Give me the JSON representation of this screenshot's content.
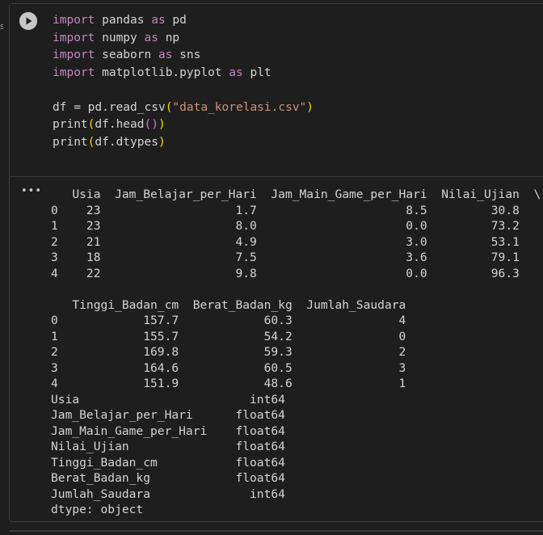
{
  "gutter": {
    "mark": "s"
  },
  "code": {
    "lines": [
      [
        {
          "t": "import",
          "c": "kw"
        },
        {
          "t": " pandas ",
          "c": "id"
        },
        {
          "t": "as",
          "c": "kw"
        },
        {
          "t": " pd",
          "c": "id"
        }
      ],
      [
        {
          "t": "import",
          "c": "kw"
        },
        {
          "t": " numpy ",
          "c": "id"
        },
        {
          "t": "as",
          "c": "kw"
        },
        {
          "t": " np",
          "c": "id"
        }
      ],
      [
        {
          "t": "import",
          "c": "kw"
        },
        {
          "t": " seaborn ",
          "c": "id"
        },
        {
          "t": "as",
          "c": "kw"
        },
        {
          "t": " sns",
          "c": "id"
        }
      ],
      [
        {
          "t": "import",
          "c": "kw"
        },
        {
          "t": " matplotlib.pyplot ",
          "c": "id"
        },
        {
          "t": "as",
          "c": "kw"
        },
        {
          "t": " plt",
          "c": "id"
        }
      ],
      [],
      [
        {
          "t": "df = pd.read_csv",
          "c": "id"
        },
        {
          "t": "(",
          "c": "br1"
        },
        {
          "t": "\"data_korelasi.csv\"",
          "c": "str"
        },
        {
          "t": ")",
          "c": "br1"
        }
      ],
      [
        {
          "t": "print",
          "c": "id"
        },
        {
          "t": "(",
          "c": "br1"
        },
        {
          "t": "df.head",
          "c": "id"
        },
        {
          "t": "()",
          "c": "br2"
        },
        {
          "t": ")",
          "c": "br1"
        }
      ],
      [
        {
          "t": "print",
          "c": "id"
        },
        {
          "t": "(",
          "c": "br1"
        },
        {
          "t": "df.dtypes",
          "c": "id"
        },
        {
          "t": ")",
          "c": "br1"
        }
      ]
    ]
  },
  "output": {
    "menu_label": "•••",
    "lines": [
      "   Usia  Jam_Belajar_per_Hari  Jam_Main_Game_per_Hari  Nilai_Ujian  \\",
      "0    23                   1.7                     8.5         30.8   ",
      "1    23                   8.0                     0.0         73.2   ",
      "2    21                   4.9                     3.0         53.1   ",
      "3    18                   7.5                     3.6         79.1   ",
      "4    22                   9.8                     0.0         96.3   ",
      "",
      "   Tinggi_Badan_cm  Berat_Badan_kg  Jumlah_Saudara  ",
      "0            157.7            60.3               4  ",
      "1            155.7            54.2               0  ",
      "2            169.8            59.3               2  ",
      "3            164.6            60.5               3  ",
      "4            151.9            48.6               1  ",
      "Usia                        int64",
      "Jam_Belajar_per_Hari      float64",
      "Jam_Main_Game_per_Hari    float64",
      "Nilai_Ujian               float64",
      "Tinggi_Badan_cm           float64",
      "Berat_Badan_kg            float64",
      "Jumlah_Saudara              int64",
      "dtype: object"
    ]
  },
  "icons": {
    "run": "play-icon",
    "menu": "more-horizontal-icon"
  },
  "colors": {
    "background": "#1e1e1e",
    "keyword": "#c586c0",
    "string": "#ce9178",
    "bracket_outer": "#ffd700",
    "bracket_inner": "#da70d6",
    "text": "#d4d4d4"
  }
}
